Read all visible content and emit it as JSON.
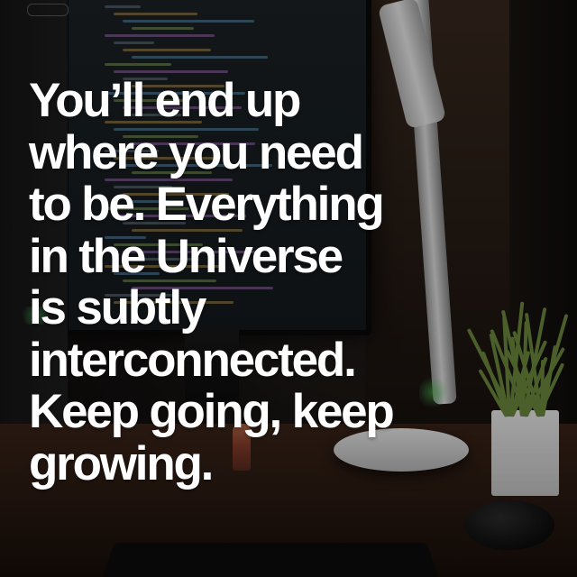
{
  "quote": {
    "lines": [
      "You’ll end up",
      "where you need",
      "to be. Everything",
      "in the Universe",
      "is subtly",
      "interconnected.",
      "Keep going, keep",
      "growing."
    ]
  },
  "colors": {
    "text": "#ffffff",
    "desk": "#2a1a12",
    "monitor_screen": "#1c2226",
    "plant": "#6e8c3f"
  }
}
